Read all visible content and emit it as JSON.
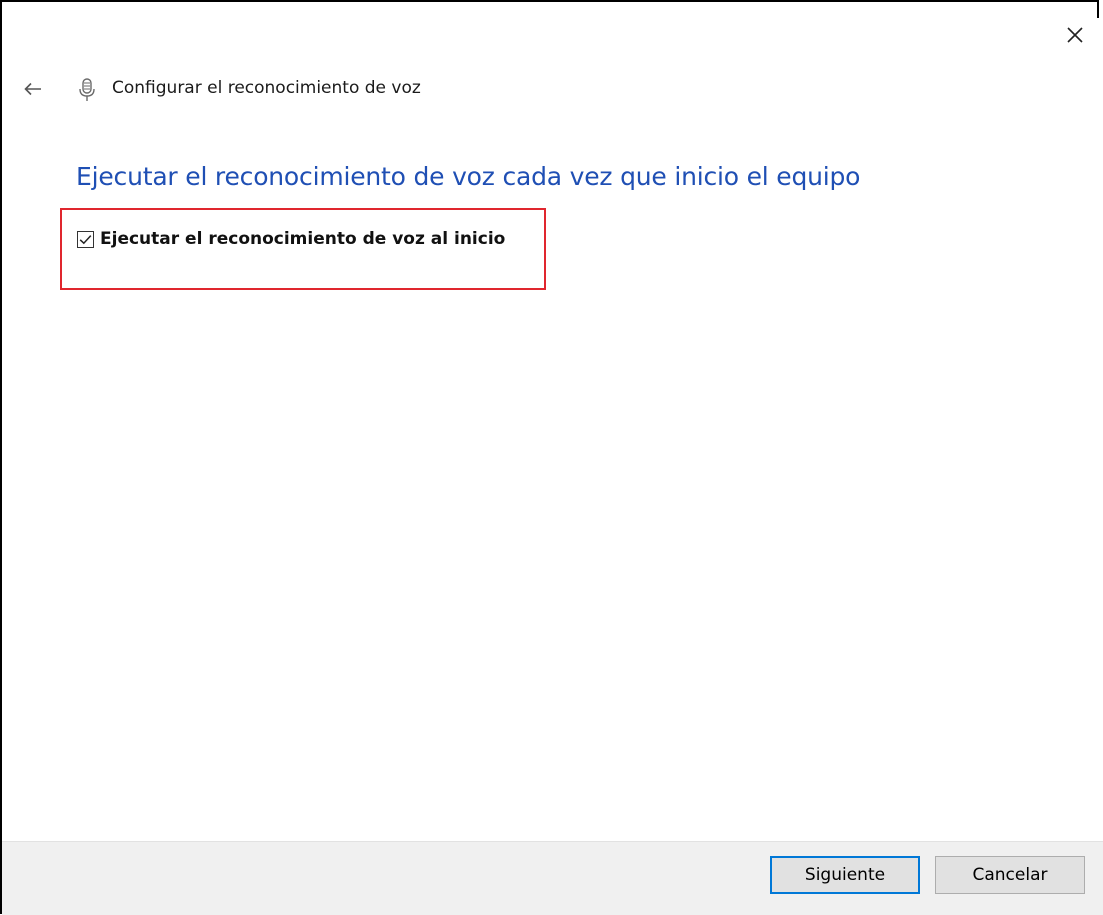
{
  "window": {
    "title": "Configurar el reconocimiento de voz",
    "back_icon": "arrow-left-icon",
    "app_icon": "microphone-icon",
    "close_icon": "close-icon"
  },
  "content": {
    "heading": "Ejecutar el reconocimiento de voz cada vez que inicio el equipo",
    "heading_color": "#1f4fb4",
    "checkbox": {
      "label": "Ejecutar el reconocimiento de voz al inicio",
      "checked": true
    },
    "highlight_color": "#e0262e"
  },
  "footer": {
    "next_label": "Siguiente",
    "cancel_label": "Cancelar",
    "accent": "#0078d7"
  }
}
